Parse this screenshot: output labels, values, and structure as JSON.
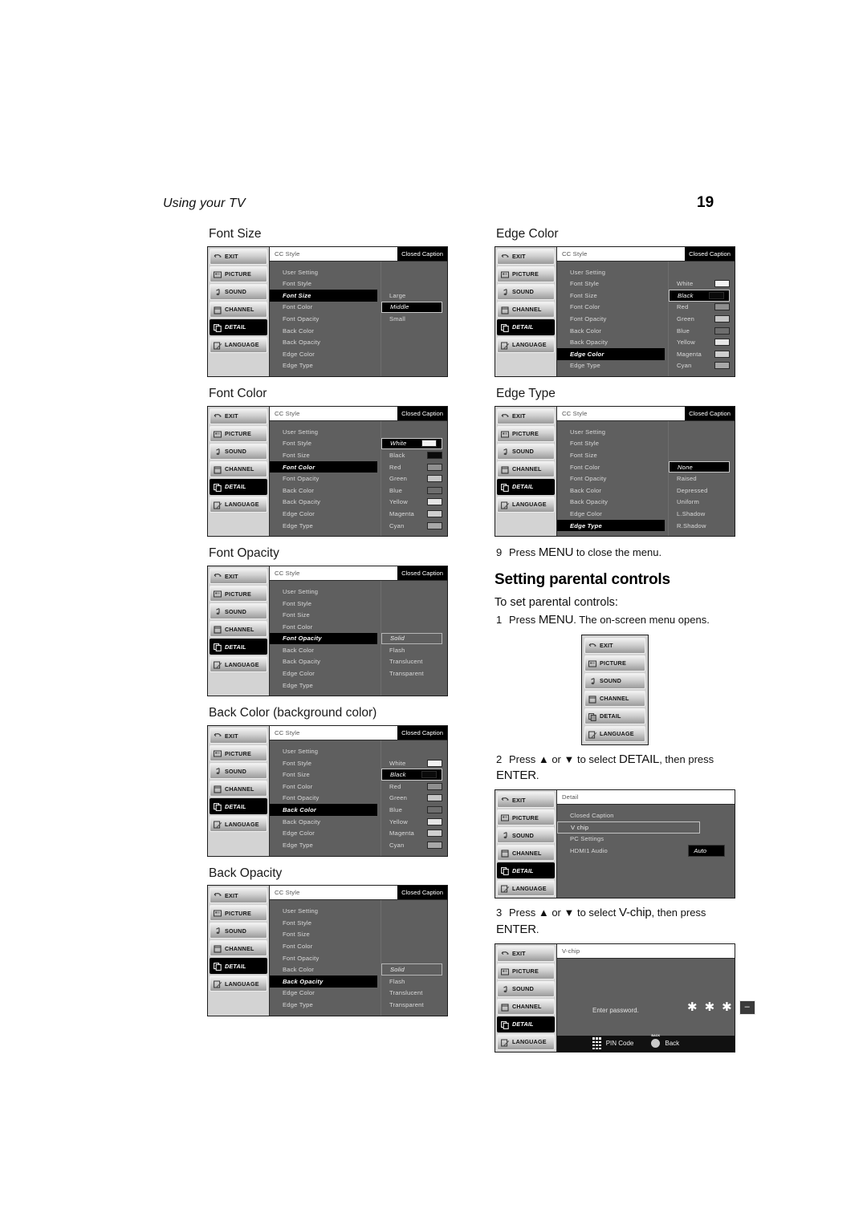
{
  "header": {
    "running_head": "Using your TV",
    "page_number": "19"
  },
  "osd_common": {
    "rail_items": [
      {
        "label": "EXIT",
        "icon": "exit-arrow-icon"
      },
      {
        "label": "PICTURE",
        "icon": "picture-icon"
      },
      {
        "label": "SOUND",
        "icon": "music-note-icon"
      },
      {
        "label": "CHANNEL",
        "icon": "channel-icon"
      },
      {
        "label": "DETAIL",
        "icon": "layers-icon"
      },
      {
        "label": "LANGUAGE",
        "icon": "pencil-note-icon"
      }
    ],
    "selected_rail": "DETAIL",
    "title": "CC Style",
    "tag": "Closed Caption",
    "menu_items": [
      "User Setting",
      "Font Style",
      "Font Size",
      "Font Color",
      "Font Opacity",
      "Back Color",
      "Back Opacity",
      "Edge Color",
      "Edge Type"
    ],
    "color_options": [
      {
        "label": "White",
        "swatch": "#f2f2f2"
      },
      {
        "label": "Black",
        "swatch": "#0a0a0a"
      },
      {
        "label": "Red",
        "swatch": "#8f8f8f"
      },
      {
        "label": "Green",
        "swatch": "#c6c6c6"
      },
      {
        "label": "Blue",
        "swatch": "#6e6e6e"
      },
      {
        "label": "Yellow",
        "swatch": "#e6e6e6"
      },
      {
        "label": "Magenta",
        "swatch": "#cfcfcf"
      },
      {
        "label": "Cyan",
        "swatch": "#a8a8a8"
      }
    ],
    "opacity_options": [
      "Solid",
      "Flash",
      "Translucent",
      "Transparent"
    ],
    "size_options": [
      "Large",
      "Middle",
      "Small"
    ],
    "edge_type_options": [
      "None",
      "Raised",
      "Depressed",
      "Uniform",
      "L.Shadow",
      "R.Shadow"
    ]
  },
  "figures": {
    "font_size": {
      "caption": "Font Size",
      "highlight": "Font Size",
      "value": "Middle"
    },
    "font_color": {
      "caption": "Font Color",
      "highlight": "Font Color",
      "value": "White"
    },
    "font_opacity": {
      "caption": "Font Opacity",
      "highlight": "Font Opacity",
      "value": "Solid"
    },
    "back_color": {
      "caption": "Back Color (background color)",
      "highlight": "Back Color",
      "value": "Black"
    },
    "back_opacity": {
      "caption": "Back Opacity",
      "highlight": "Back Opacity",
      "value": "Solid"
    },
    "edge_color": {
      "caption": "Edge Color",
      "highlight": "Edge Color",
      "value": "Black"
    },
    "edge_type": {
      "caption": "Edge Type",
      "highlight": "Edge Type",
      "value": "None"
    }
  },
  "step9": {
    "number": "9",
    "pre": "Press ",
    "key": "MENU",
    "post": " to close the menu."
  },
  "parental": {
    "heading": "Setting parental controls",
    "lead": "To set parental controls:",
    "step1": {
      "number": "1",
      "pre": "Press ",
      "key": "MENU",
      "post": ". The on-screen menu opens."
    },
    "step2": {
      "number": "2",
      "pre": "Press ▲ or ▼ to select ",
      "key": "DETAIL",
      "mid": ", then press ",
      "key2": "ENTER",
      "post": "."
    },
    "step3": {
      "number": "3",
      "pre": "Press ▲ or ▼ to select ",
      "key": "V-chip",
      "mid": ", then press ",
      "key2": "ENTER",
      "post": "."
    }
  },
  "detail_menu": {
    "title": "Detail",
    "items": [
      "Closed Caption",
      "V chip",
      "PC Settings",
      "HDMI1 Audio"
    ],
    "selected": "V chip",
    "hdmi_value": "Auto"
  },
  "vchip_menu": {
    "title": "V-chip",
    "prompt": "Enter password.",
    "mask": [
      "✱",
      "✱",
      "✱"
    ],
    "cursor": "–",
    "footer_pin": "PIN Code",
    "footer_back": "Back"
  }
}
